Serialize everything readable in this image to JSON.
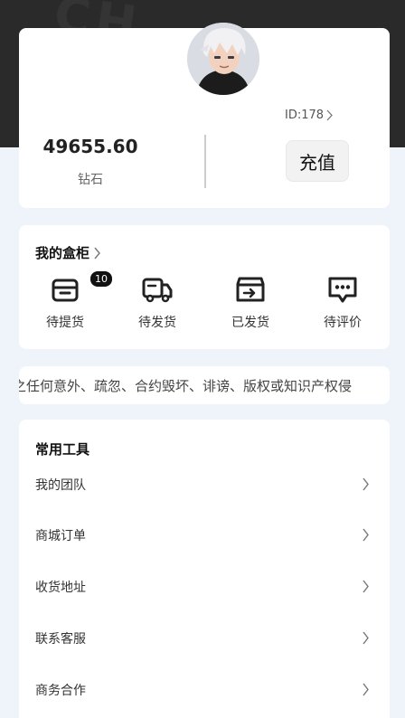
{
  "header": {
    "watermark": "CH"
  },
  "profile": {
    "id_label": "ID:178",
    "balance_value": "49655.60",
    "balance_label": "钻石",
    "recharge_label": "充值"
  },
  "orders": {
    "title": "我的盒柜",
    "items": [
      {
        "label": "待提货",
        "icon": "box-icon",
        "badge": "10"
      },
      {
        "label": "待发货",
        "icon": "truck-icon"
      },
      {
        "label": "已发货",
        "icon": "shipped-box-icon"
      },
      {
        "label": "待评价",
        "icon": "comment-icon"
      }
    ]
  },
  "notice": {
    "text": "之任何意外、疏忽、合约毁坏、诽谤、版权或知识产权侵"
  },
  "tools": {
    "title": "常用工具",
    "items": [
      {
        "label": "我的团队"
      },
      {
        "label": "商城订单"
      },
      {
        "label": "收货地址"
      },
      {
        "label": "联系客服"
      },
      {
        "label": "商务合作"
      }
    ]
  }
}
